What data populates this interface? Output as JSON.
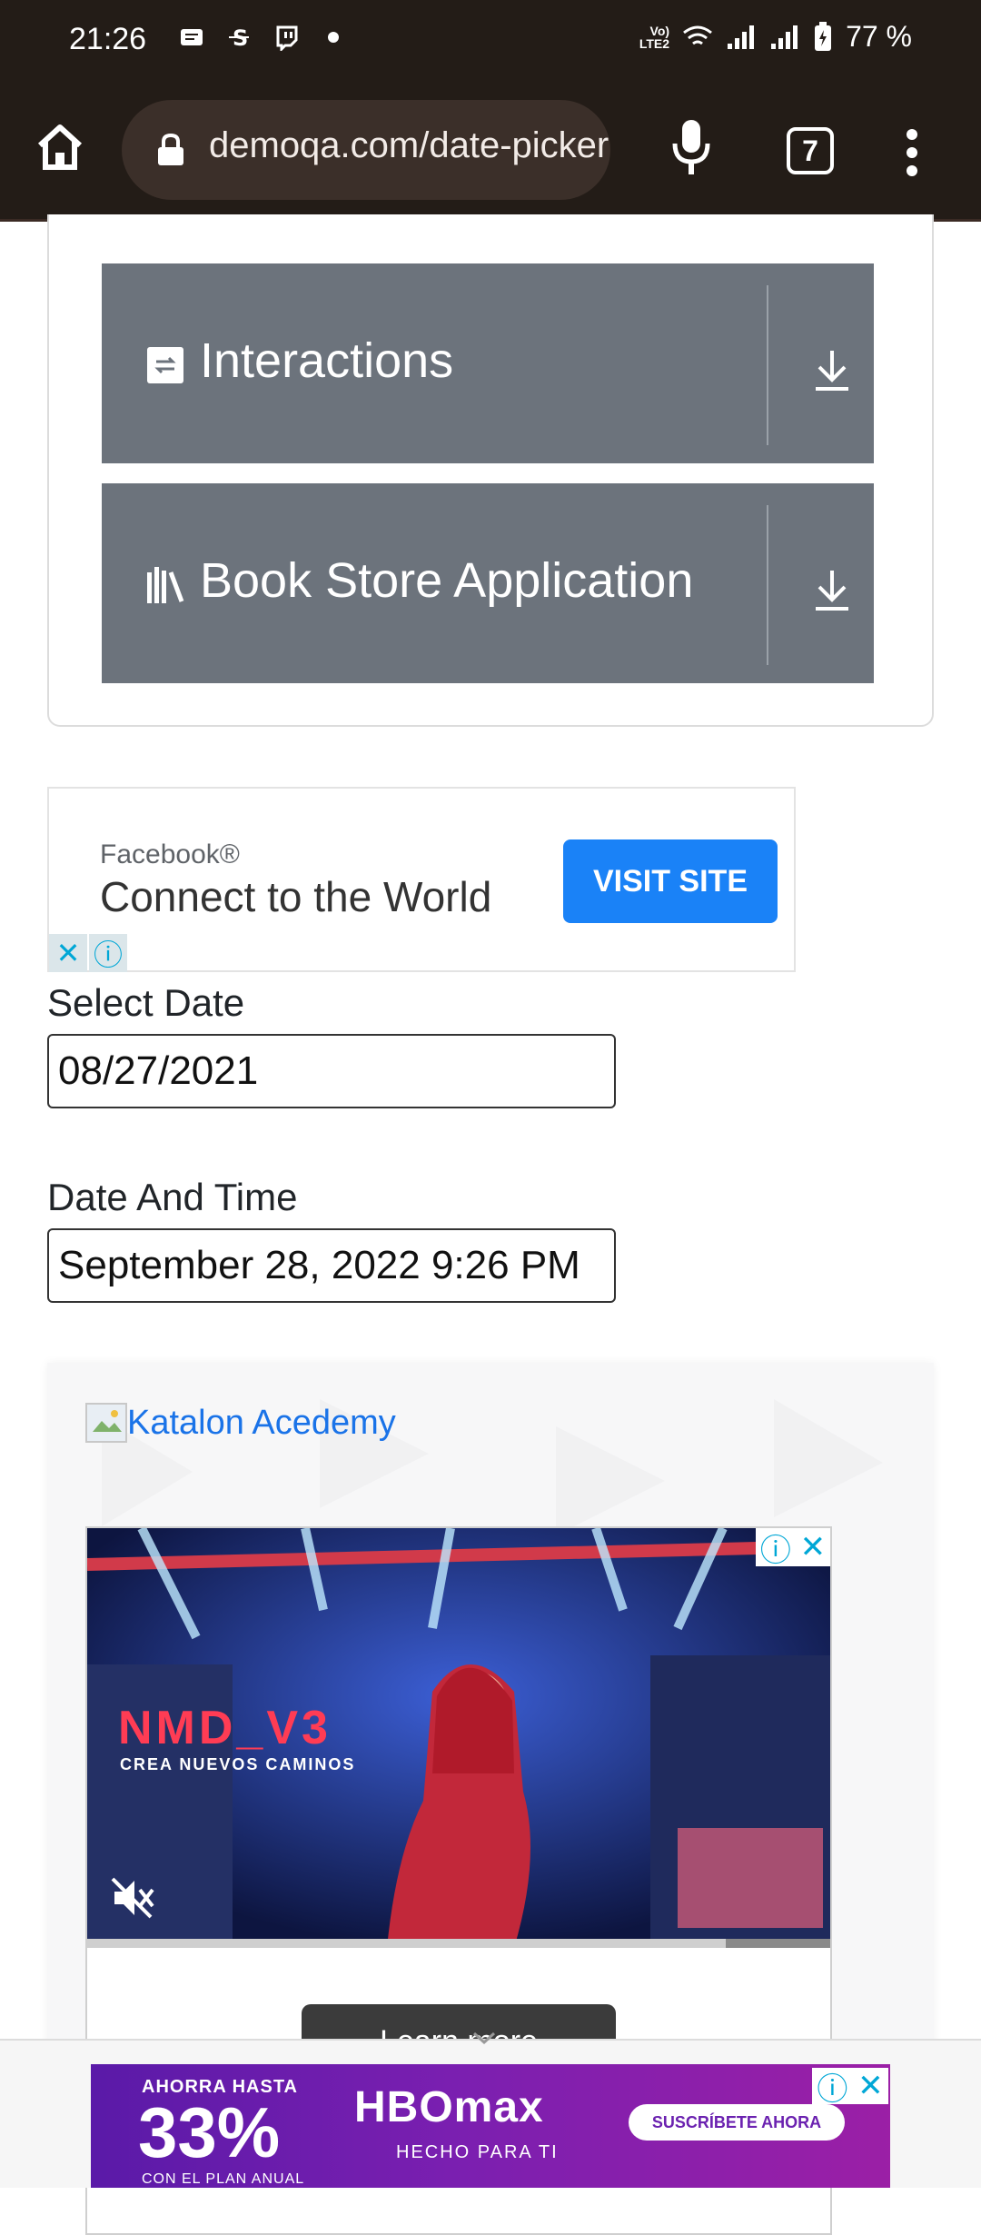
{
  "status_bar": {
    "time": "21:26",
    "network_label": "VoLTE LTE2",
    "battery": "77 %"
  },
  "browser": {
    "url": "demoqa.com/date-picker",
    "tab_count": "7"
  },
  "groups": [
    {
      "label": "Interactions",
      "icon": "interactions-icon"
    },
    {
      "label": "Book Store Application",
      "icon": "book-store-icon"
    }
  ],
  "fb_ad": {
    "brand": "Facebook®",
    "headline": "Connect to the World",
    "cta": "VISIT SITE"
  },
  "form": {
    "select_date_label": "Select Date",
    "select_date_value": "08/27/2021",
    "date_time_label": "Date And Time",
    "date_time_value": "September 28, 2022 9:26 PM"
  },
  "katalon": {
    "link_text": "Katalon Acedemy"
  },
  "video_ad": {
    "title": "NMD_V3",
    "subtitle": "CREA NUEVOS CAMINOS",
    "learn_more": "Learn more",
    "progress": 0.86
  },
  "hbo_ad": {
    "top_text": "AHORRA HASTA",
    "percent": "33%",
    "plan_text": "CON EL PLAN ANUAL",
    "logo": "HBOmax",
    "tagline": "HECHO PARA TI",
    "cta": "SUSCRÍBETE AHORA"
  },
  "colors": {
    "browser_bg": "#231c17",
    "accordion_bg": "#6c737c",
    "fb_cta": "#1a82f7",
    "link": "#1a73e8"
  }
}
